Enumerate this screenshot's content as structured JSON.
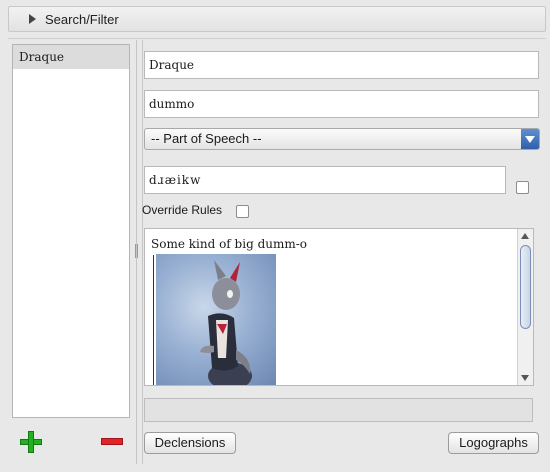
{
  "search_filter": {
    "label": "Search/Filter"
  },
  "word_list": {
    "items": [
      "Draque"
    ]
  },
  "fields": {
    "conword": "Draque",
    "localword": "dummo",
    "part_of_speech": "-- Part of Speech --",
    "pronunciation": "dɹæikw",
    "override_label": "Override Rules"
  },
  "definition": {
    "text": "Some kind of big dumm-o"
  },
  "buttons": {
    "declensions": "Declensions",
    "logographs": "Logographs"
  },
  "icons": {
    "add": "plus-icon",
    "remove": "minus-icon",
    "expand": "triangle-right-icon",
    "dropdown": "chevron-down-icon"
  },
  "colors": {
    "add": "#21b121",
    "remove": "#e2242a",
    "select_accent": "#2f5fa8"
  }
}
